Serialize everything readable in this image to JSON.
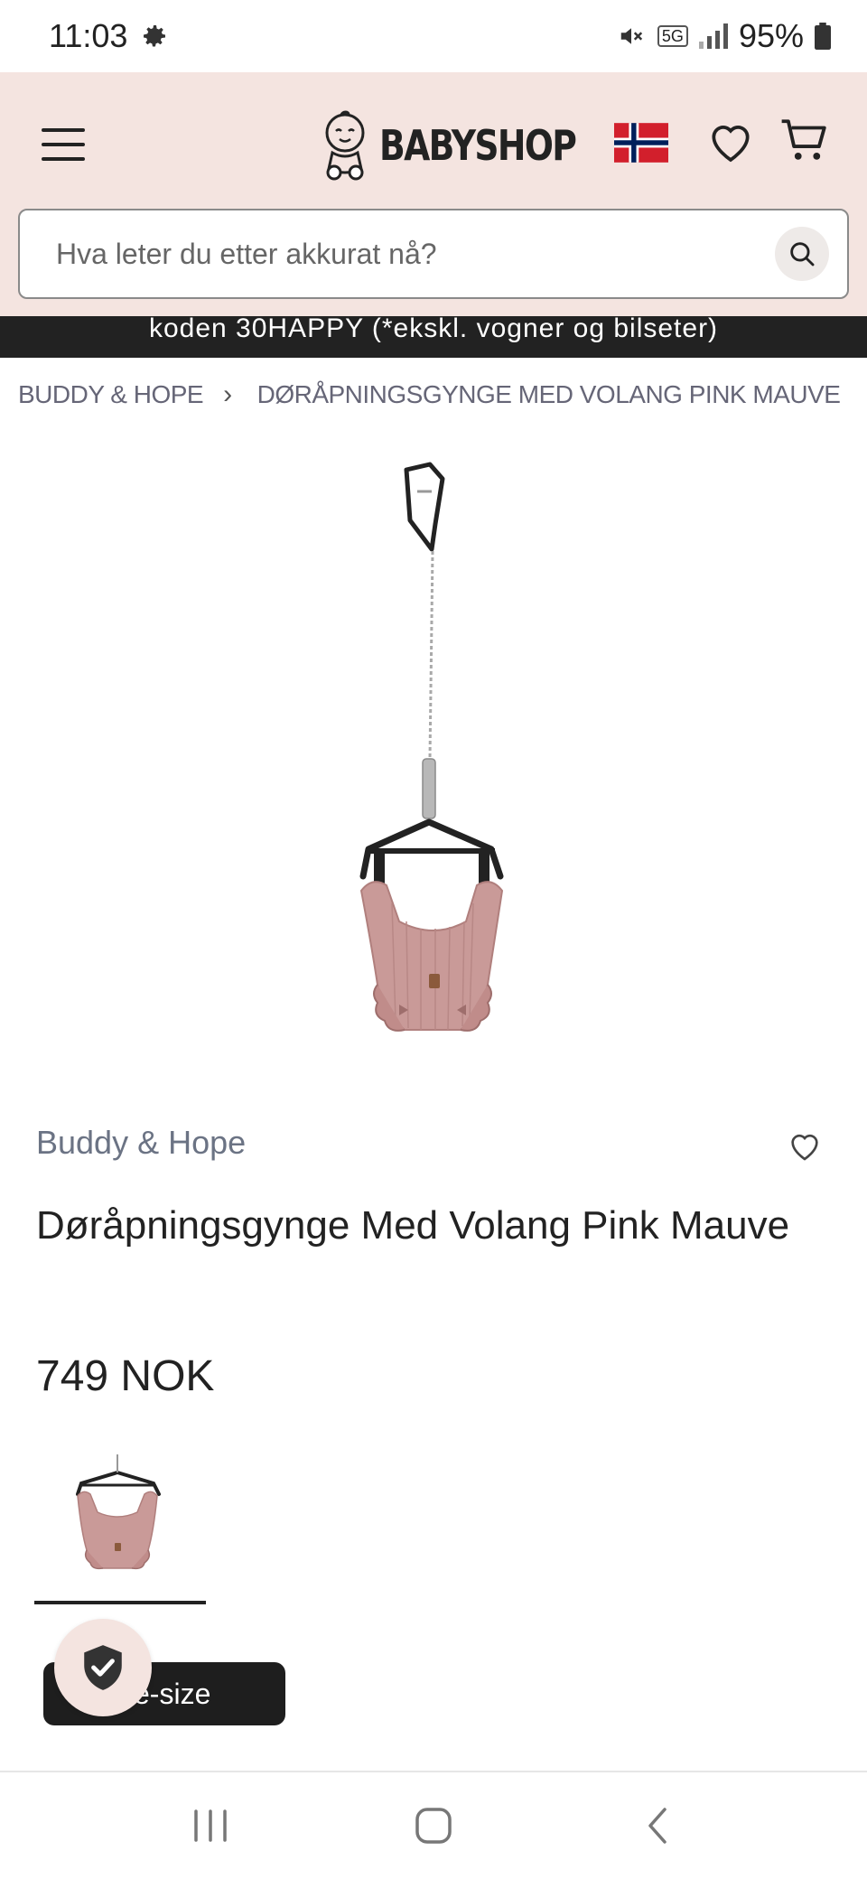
{
  "status_bar": {
    "time": "11:03",
    "network": "5G",
    "battery": "95%"
  },
  "header": {
    "logo_text": "BABYSHOP",
    "search_placeholder": "Hva leter du etter akkurat nå?"
  },
  "promo": {
    "text": "koden 30HAPPY (*ekskl. vogner og bilseter)"
  },
  "breadcrumb": {
    "items": [
      "BUDDY & HOPE",
      "DØRÅPNINGSGYNGE MED VOLANG PINK MAUVE"
    ]
  },
  "product": {
    "brand": "Buddy & Hope",
    "title": "Døråpningsgynge Med Volang Pink Mauve",
    "price": "749 NOK"
  },
  "size_button": {
    "label": "e-size"
  },
  "colors": {
    "header_bg": "#f4e4e0",
    "promo_bg": "#222222",
    "product_pink": "#c99a98",
    "text_muted": "#6b7384"
  },
  "icons": [
    "settings-icon",
    "mute-icon",
    "signal-icon",
    "battery-icon",
    "menu-icon",
    "norway-flag-icon",
    "heart-icon",
    "cart-icon",
    "search-icon",
    "chevron-right-icon",
    "shield-check-icon",
    "recent-apps-icon",
    "home-icon",
    "back-icon"
  ]
}
